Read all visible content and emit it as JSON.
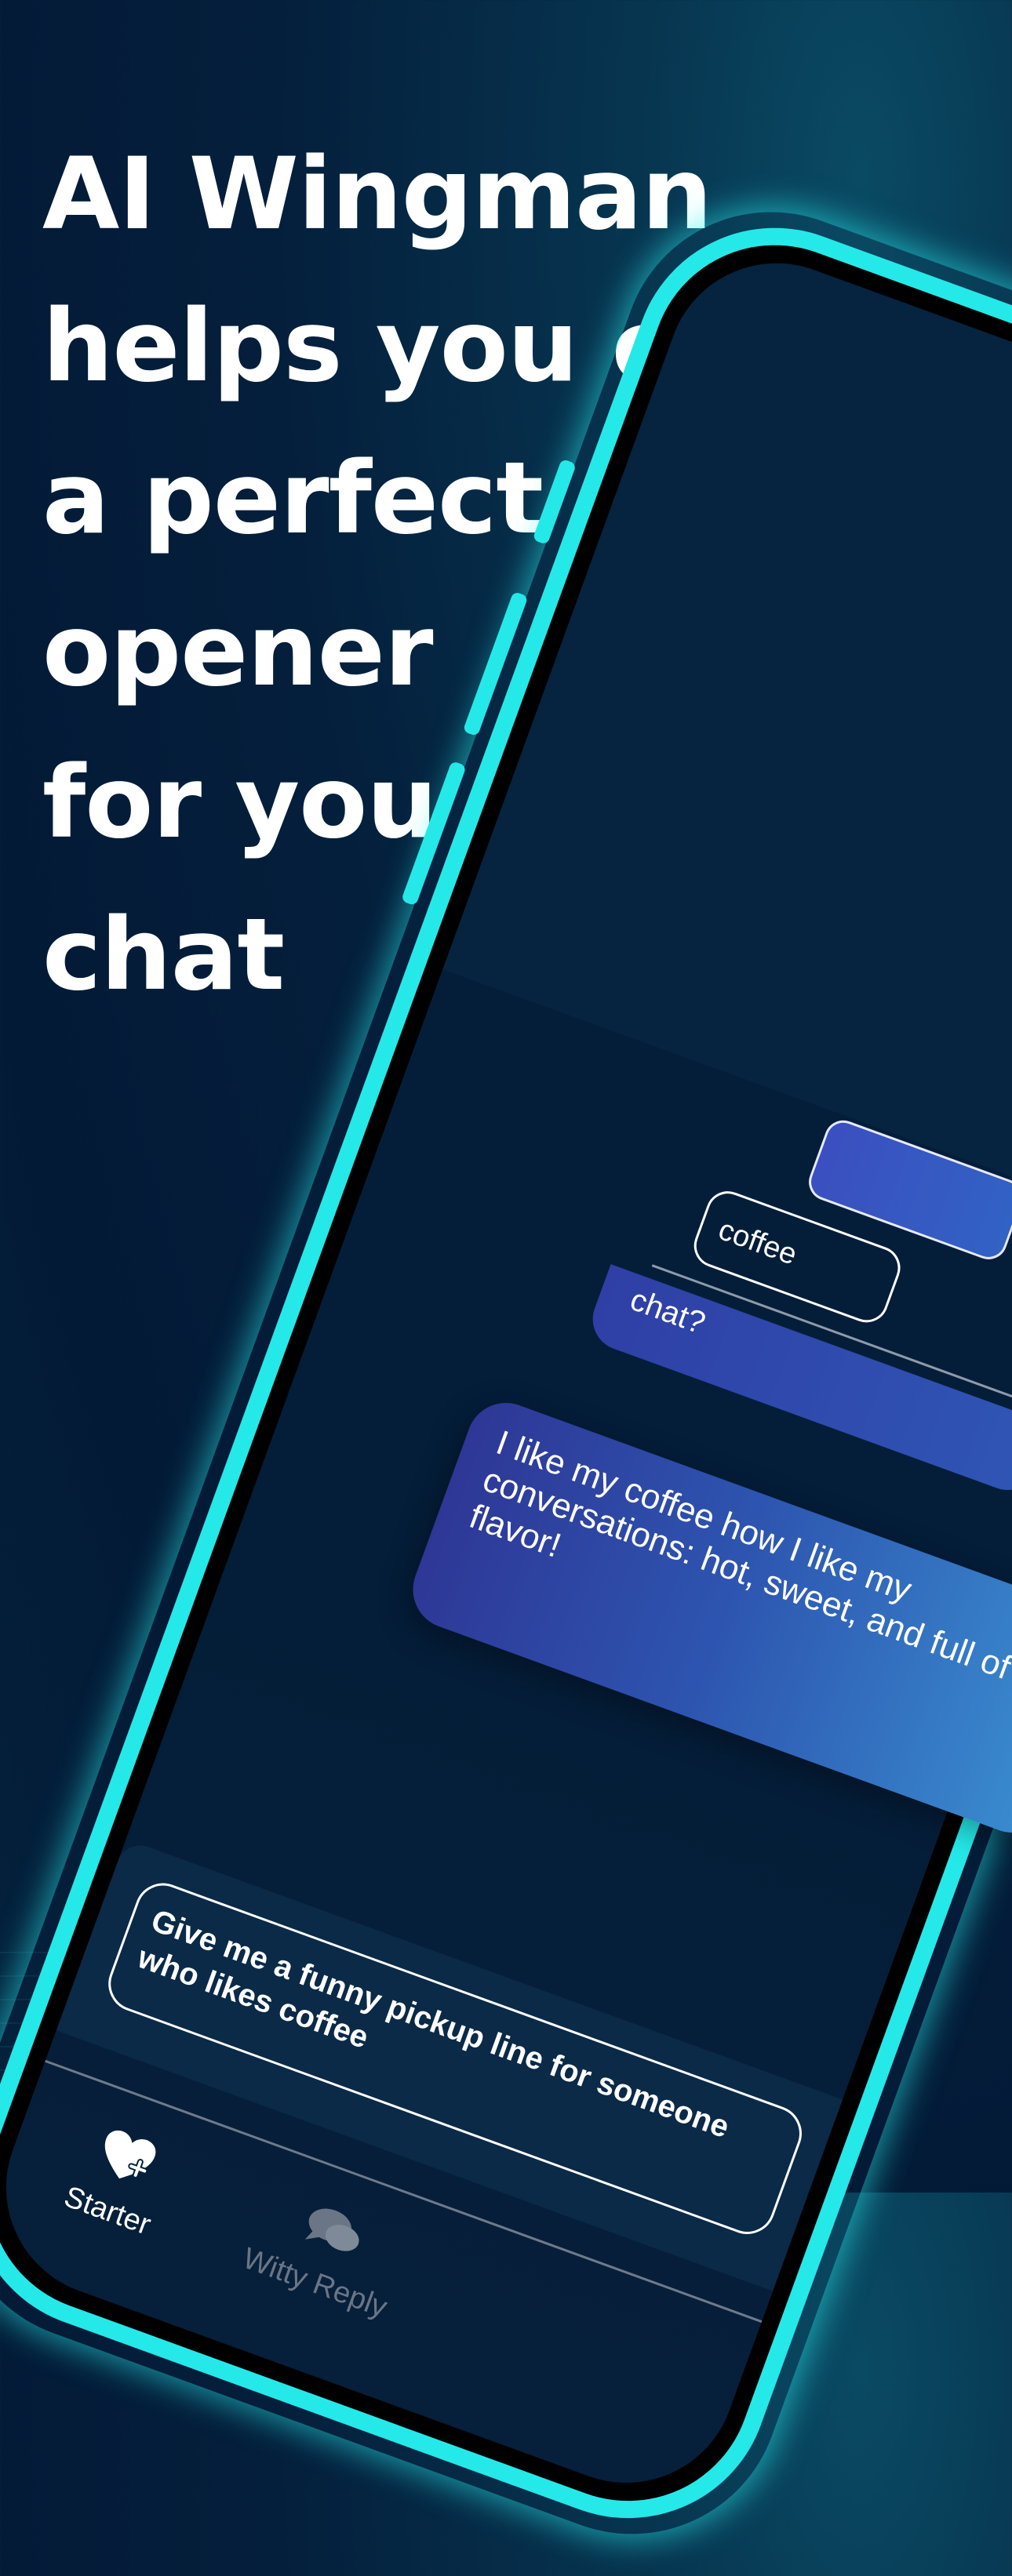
{
  "headline": {
    "lines": [
      "AI Wingman",
      "helps you craft",
      "a perfect",
      "opener",
      "for you date",
      "chat"
    ]
  },
  "phone": {
    "chip_coffee": "coffee",
    "partial_bubble": "chat?",
    "input_lines": [
      "Give me a funny pickup line for someone",
      "who likes coffee"
    ],
    "tabs": [
      {
        "label": "Starter",
        "icon": "heart-plus-icon",
        "active": true
      },
      {
        "label": "Witty Reply",
        "icon": "chat-bubbles-icon",
        "active": false
      }
    ]
  },
  "floating_bubble": {
    "lines": [
      "I like my coffee how I like my",
      "conversations: hot, sweet, and full of",
      "flavor!"
    ]
  },
  "colors": {
    "background": "#041f3c",
    "phone_frame": "#25e9e9",
    "bubble_start": "#2e3796",
    "bubble_end": "#3a8ed0",
    "text": "#ffffff"
  }
}
